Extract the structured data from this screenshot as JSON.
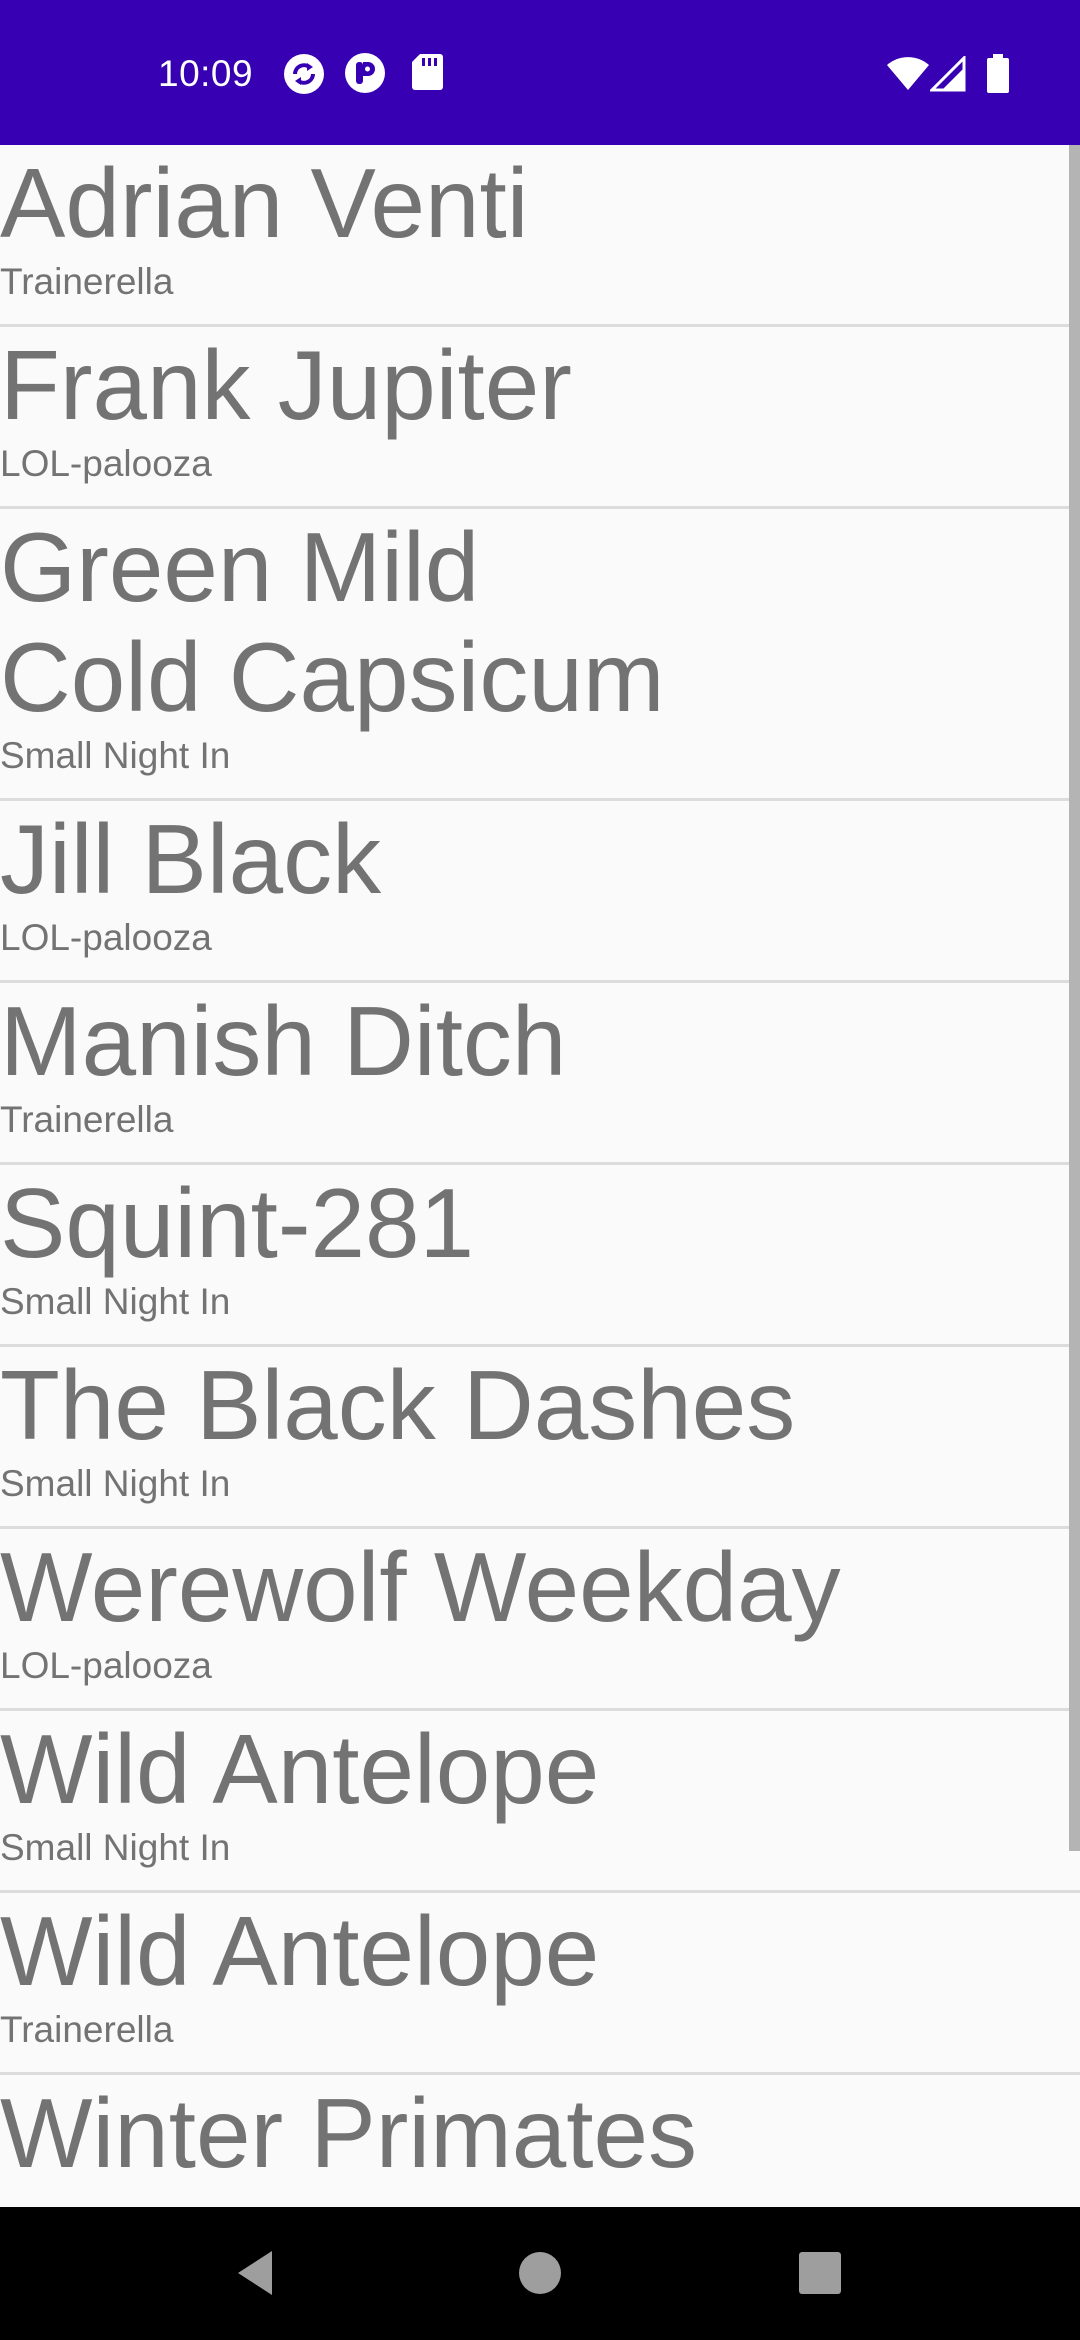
{
  "status_bar": {
    "time": "10:09",
    "color": "#3700b3",
    "left_icons": [
      "sync-icon",
      "app-notification-icon",
      "sd-card-icon"
    ],
    "right_icons": [
      "wifi-icon",
      "cell-signal-icon",
      "battery-icon"
    ]
  },
  "list": {
    "items": [
      {
        "title": "Adrian Venti",
        "subtitle": "Trainerella"
      },
      {
        "title": "Frank Jupiter",
        "subtitle": "LOL-palooza"
      },
      {
        "title": "Green Mild Cold Capsicum",
        "subtitle": "Small Night In"
      },
      {
        "title": "Jill Black",
        "subtitle": "LOL-palooza"
      },
      {
        "title": "Manish Ditch",
        "subtitle": "Trainerella"
      },
      {
        "title": "Squint-281",
        "subtitle": "Small Night In"
      },
      {
        "title": "The Black Dashes",
        "subtitle": "Small Night In"
      },
      {
        "title": "Werewolf Weekday",
        "subtitle": "LOL-palooza"
      },
      {
        "title": "Wild Antelope",
        "subtitle": "Small Night In"
      },
      {
        "title": "Wild Antelope",
        "subtitle": "Trainerella"
      },
      {
        "title": "Winter Primates",
        "subtitle": ""
      }
    ]
  },
  "nav_bar": {
    "buttons": [
      "back-icon",
      "home-icon",
      "recents-icon"
    ]
  }
}
